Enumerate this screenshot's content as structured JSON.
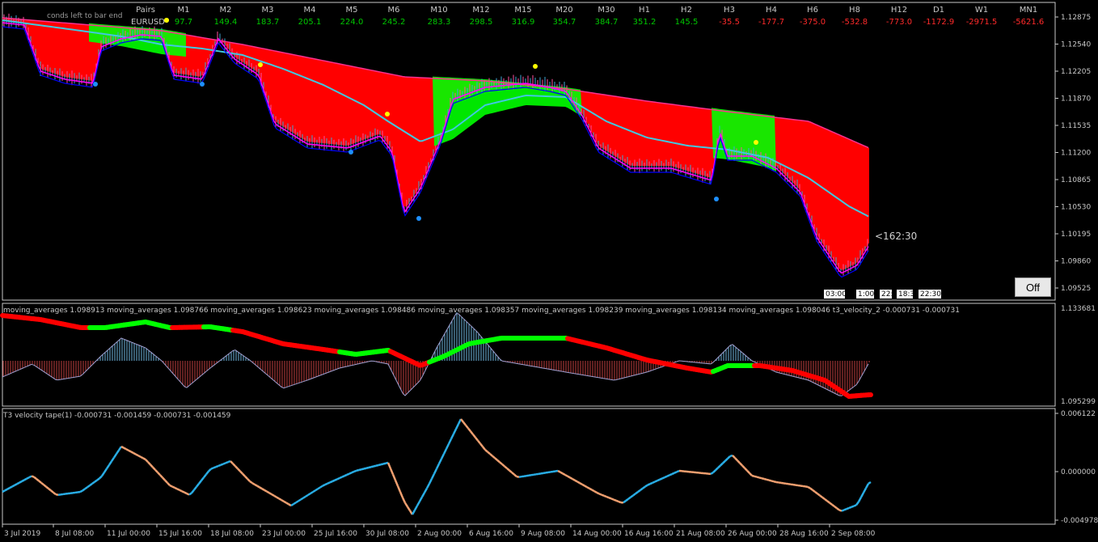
{
  "symbol": "EURUSD",
  "header": {
    "pairs_label": "Pairs",
    "partial_text": "conds left to bar end",
    "columns": [
      {
        "tf": "M1",
        "val": "97.7",
        "color": "#00c800"
      },
      {
        "tf": "M2",
        "val": "149.4",
        "color": "#00c800"
      },
      {
        "tf": "M3",
        "val": "183.7",
        "color": "#00c800"
      },
      {
        "tf": "M4",
        "val": "205.1",
        "color": "#00c800"
      },
      {
        "tf": "M5",
        "val": "224.0",
        "color": "#00c800"
      },
      {
        "tf": "M6",
        "val": "245.2",
        "color": "#00c800"
      },
      {
        "tf": "M10",
        "val": "283.3",
        "color": "#00c800"
      },
      {
        "tf": "M12",
        "val": "298.5",
        "color": "#00c800"
      },
      {
        "tf": "M15",
        "val": "316.9",
        "color": "#00c800"
      },
      {
        "tf": "M20",
        "val": "354.7",
        "color": "#00c800"
      },
      {
        "tf": "M30",
        "val": "384.7",
        "color": "#00c800"
      },
      {
        "tf": "H1",
        "val": "351.2",
        "color": "#00c800"
      },
      {
        "tf": "H2",
        "val": "145.5",
        "color": "#00c800"
      },
      {
        "tf": "H3",
        "val": "-35.5",
        "color": "#ff2a2a"
      },
      {
        "tf": "H4",
        "val": "-177.7",
        "color": "#ff2a2a"
      },
      {
        "tf": "H6",
        "val": "-375.0",
        "color": "#ff2a2a"
      },
      {
        "tf": "H8",
        "val": "-532.8",
        "color": "#ff2a2a"
      },
      {
        "tf": "H12",
        "val": "-773.0",
        "color": "#ff2a2a"
      },
      {
        "tf": "D1",
        "val": "-1172.9",
        "color": "#ff2a2a"
      },
      {
        "tf": "W1",
        "val": "-2971.5",
        "color": "#ff2a2a"
      },
      {
        "tf": "MN1",
        "val": "-5621.6",
        "color": "#ff2a2a"
      }
    ]
  },
  "price_axis": [
    "1.12875",
    "1.12540",
    "1.12205",
    "1.11870",
    "1.11535",
    "1.11200",
    "1.10865",
    "1.10530",
    "1.10195",
    "1.09860",
    "1.09525"
  ],
  "sub1_axis": [
    "1.133681",
    "1.095299"
  ],
  "sub2_axis": [
    "0.006122",
    "0.000000",
    "-0.004978"
  ],
  "sub1_label": "moving_averages 1.098913 moving_averages 1.098766 moving_averages 1.098623 moving_averages 1.098486 moving_averages 1.098357 moving_averages 1.098239 moving_averages 1.098134 moving_averages 1.098046 t3_velocity_2 -0.000731 -0.000731",
  "sub2_label": "T3 velocity tape(1) -0.000731 -0.001459 -0.000731 -0.001459",
  "time_axis": [
    "3 Jul 2019",
    "8 Jul 08:00",
    "11 Jul 00:00",
    "15 Jul 16:00",
    "18 Jul 08:00",
    "23 Jul 00:00",
    "25 Jul 16:00",
    "30 Jul 08:00",
    "2 Aug 00:00",
    "6 Aug 16:00",
    "9 Aug 08:00",
    "14 Aug 00:00",
    "16 Aug 16:00",
    "21 Aug 08:00",
    "26 Aug 00:00",
    "28 Aug 16:00",
    "2 Sep 08:00"
  ],
  "countdown": "<162:30",
  "time_boxes": [
    "03:00",
    "1:00",
    "22:",
    "18:3",
    "22:30"
  ],
  "off_label": "Off",
  "colors": {
    "bear": "#ff0000",
    "bull": "#00ff00",
    "ma_fast": "#ff00ff",
    "ma_slow": "#40c8e0",
    "ma_base": "#0000ff",
    "signal_blue": "#1e90ff",
    "signal_yellow": "#ffff00",
    "tape_up": "#29aee6",
    "tape_down": "#f0a070"
  }
}
